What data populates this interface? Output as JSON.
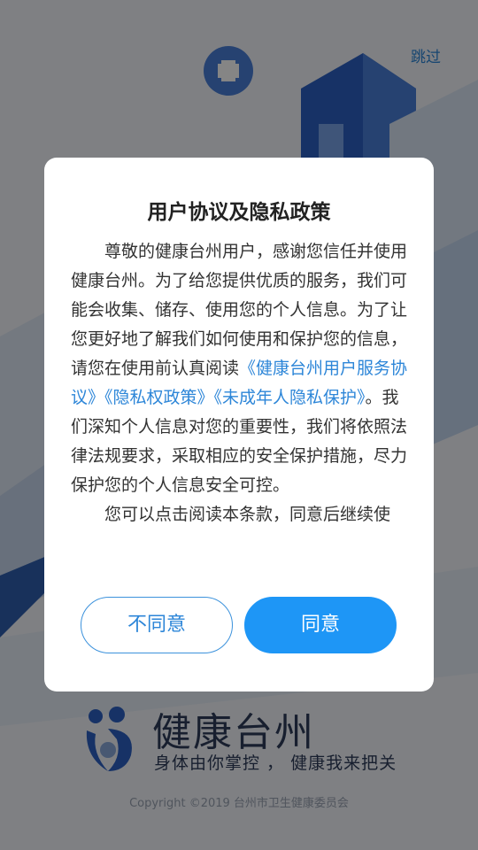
{
  "splash": {
    "skip_label": "跳过",
    "brand_name": "健康台州",
    "slogan": "身体由你掌控 ， 健康我来把关",
    "copyright": "Copyright ©2019  台州市卫生健康委员会"
  },
  "dialog": {
    "title": "用户协议及隐私政策",
    "para1_text_a": "尊敬的健康台州用户，感谢您信任并使用健康台州。为了给您提供优质的服务，我们可能会收集、储存、使用您的个人信息。为了让您更好地了解我们如何使用和保护您的信息，请您在使用前认真阅读",
    "link_service": "《健康台州用户服务协议》",
    "link_privacy": "《隐私权政策》",
    "link_minor": "《未成年人隐私保护》",
    "para1_text_b": "。我们深知个人信息对您的重要性，我们将依照法律法规要求，采取相应的安全保护措施，尽力保护您的个人信息安全可控。",
    "para2_text": "您可以点击阅读本条款，同意后继续使",
    "disagree_label": "不同意",
    "agree_label": "同意"
  },
  "colors": {
    "accent": "#1e96f6",
    "link": "#2d86d8",
    "overlay": "rgba(0,0,0,0.48)"
  },
  "icons": [
    "medical-cross-icon",
    "family-logo-icon"
  ]
}
